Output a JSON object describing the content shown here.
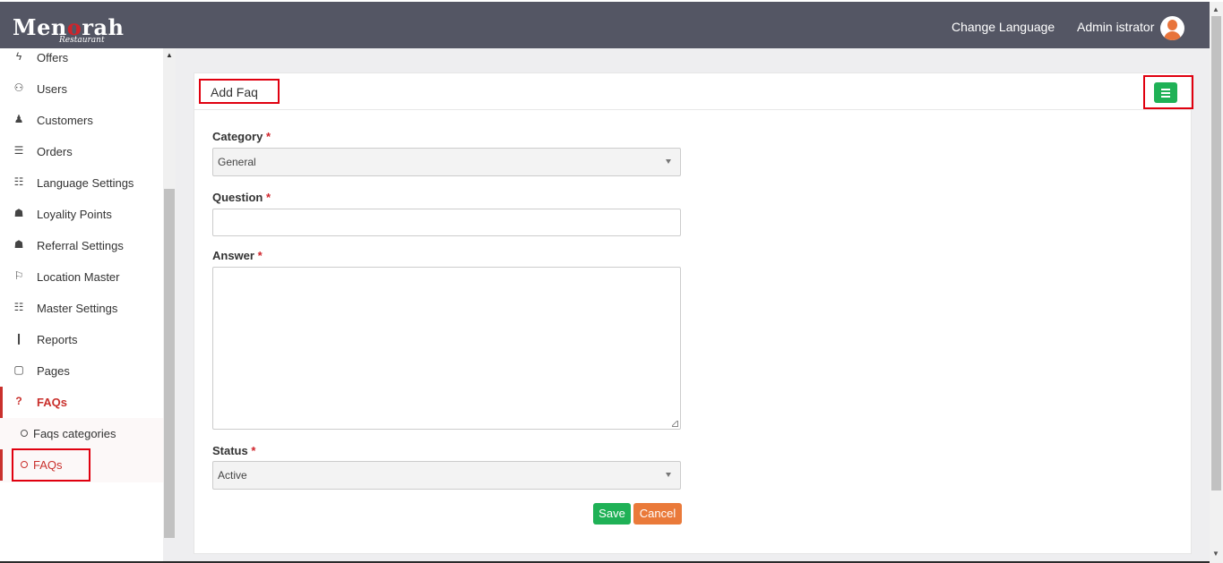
{
  "header": {
    "logo_text_a": "Men",
    "logo_text_b": "o",
    "logo_text_c": "rah",
    "logo_sub": "Restaurant",
    "change_language": "Change Language",
    "user_name": "Admin istrator"
  },
  "sidebar": {
    "items": [
      {
        "label": "Offers",
        "icon": "bolt-icon",
        "glyph": "ϟ"
      },
      {
        "label": "Users",
        "icon": "users-icon",
        "glyph": "⚇"
      },
      {
        "label": "Customers",
        "icon": "user-icon",
        "glyph": "♟"
      },
      {
        "label": "Orders",
        "icon": "list-icon",
        "glyph": "☰"
      },
      {
        "label": "Language Settings",
        "icon": "language-icon",
        "glyph": "☷"
      },
      {
        "label": "Loyality Points",
        "icon": "gift-icon",
        "glyph": "☗"
      },
      {
        "label": "Referral Settings",
        "icon": "gift-icon",
        "glyph": "☗"
      },
      {
        "label": "Location Master",
        "icon": "map-marker-icon",
        "glyph": "⚐"
      },
      {
        "label": "Master Settings",
        "icon": "qrcode-icon",
        "glyph": "☷"
      },
      {
        "label": "Reports",
        "icon": "bar-chart-icon",
        "glyph": "❙"
      },
      {
        "label": "Pages",
        "icon": "square-icon",
        "glyph": "▢"
      },
      {
        "label": "FAQs",
        "icon": "question-icon",
        "glyph": "?"
      }
    ],
    "submenu": [
      {
        "label": "Faqs categories"
      },
      {
        "label": "FAQs"
      }
    ]
  },
  "form": {
    "title": "Add Faq",
    "category_label": "Category",
    "category_value": "General",
    "question_label": "Question",
    "question_value": "",
    "answer_label": "Answer",
    "answer_value": "",
    "status_label": "Status",
    "status_value": "Active",
    "required_mark": "*",
    "save_label": "Save",
    "cancel_label": "Cancel"
  },
  "colors": {
    "topbar": "#545664",
    "accent_red": "#c9302c",
    "save_green": "#1fb156",
    "cancel_orange": "#ea7a3a"
  }
}
